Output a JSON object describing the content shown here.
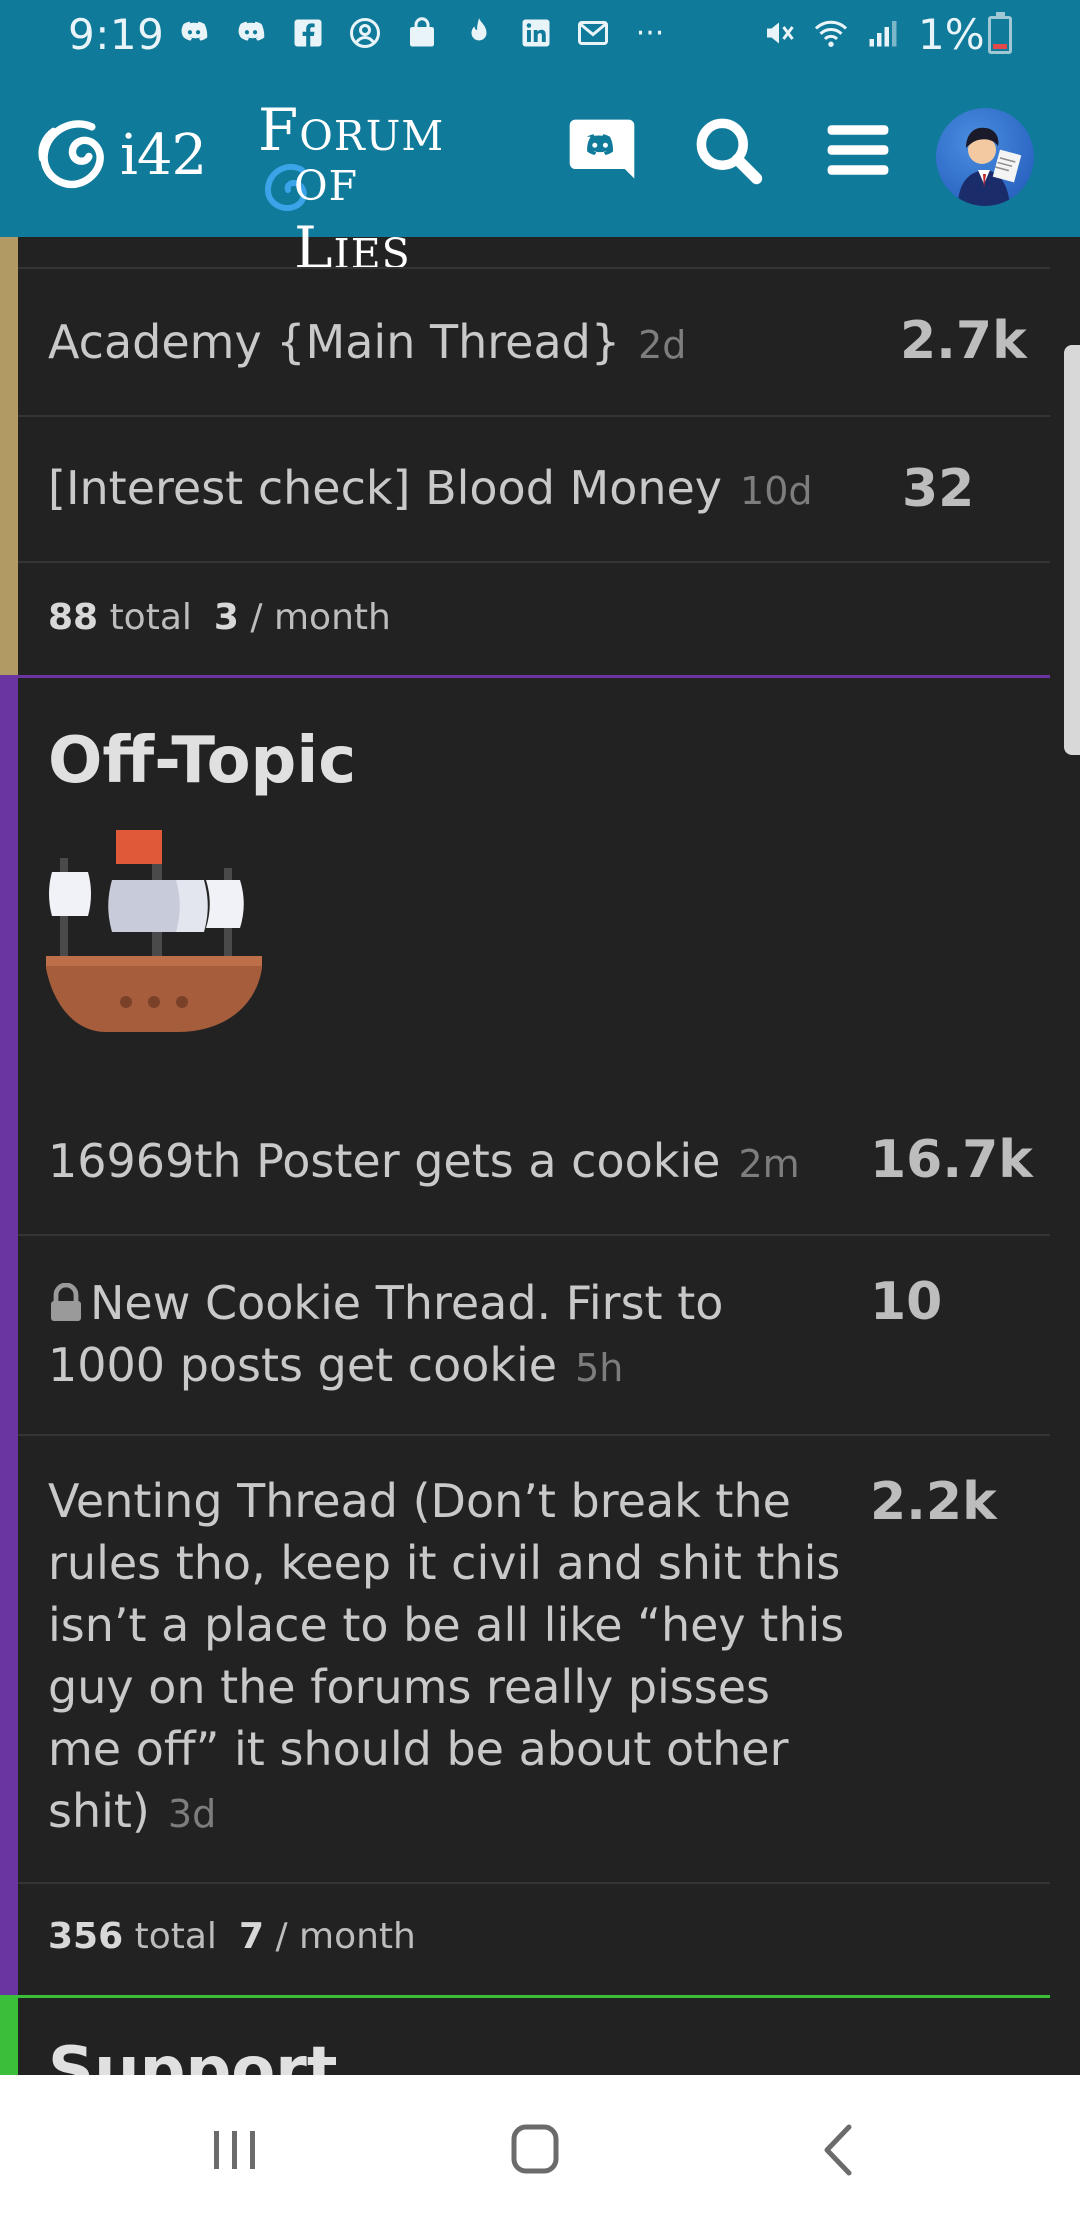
{
  "status_bar": {
    "time": "9:19",
    "battery": "1%",
    "notification_icons": [
      "discord-icon",
      "discord-icon",
      "facebook-icon",
      "messenger-icon",
      "shopping-bag-icon",
      "tinder-icon",
      "linkedin-icon",
      "gmail-icon",
      "more-dots-icon"
    ],
    "system_icons": [
      "mute-icon",
      "wifi-icon",
      "signal-icon",
      "battery-icon"
    ],
    "more": "···"
  },
  "header": {
    "logo_i42": "i42",
    "logo_forum_line1": "Forum",
    "logo_forum_line2": "of Lies",
    "accent_color": "#0f7a9a"
  },
  "categories": {
    "academy": {
      "stripe_color": "#b29a64",
      "topics": [
        {
          "title": "Academy {Main Thread}",
          "age": "2d",
          "count": "2.7k"
        },
        {
          "title": "[Interest check] Blood Money",
          "age": "10d",
          "count": "32"
        }
      ],
      "footer": {
        "total": "88",
        "total_label": "total",
        "rate": "3",
        "rate_label": "/ month"
      }
    },
    "offtopic": {
      "title": "Off-Topic",
      "stripe_color": "#6a35a1",
      "topics": [
        {
          "title": "16969th Poster gets a cookie",
          "age": "2m",
          "count": "16.7k"
        },
        {
          "title_line1": "New Cookie Thread. First to",
          "title_line2": "1000 posts get cookie",
          "age": "5h",
          "count": "10",
          "locked": true
        },
        {
          "title_lines": [
            "Venting Thread (Don’t break the",
            "rules tho, keep it civil and shit this",
            "isn’t a place to be all like “hey this",
            "guy on the forums really pisses",
            "me off” it should be about other",
            "shit)"
          ],
          "age": "3d",
          "count": "2.2k"
        }
      ],
      "footer": {
        "total": "356",
        "total_label": "total",
        "rate": "7",
        "rate_label": "/ month"
      }
    },
    "support": {
      "title": "Support",
      "stripe_color": "#3bbf3b"
    }
  }
}
